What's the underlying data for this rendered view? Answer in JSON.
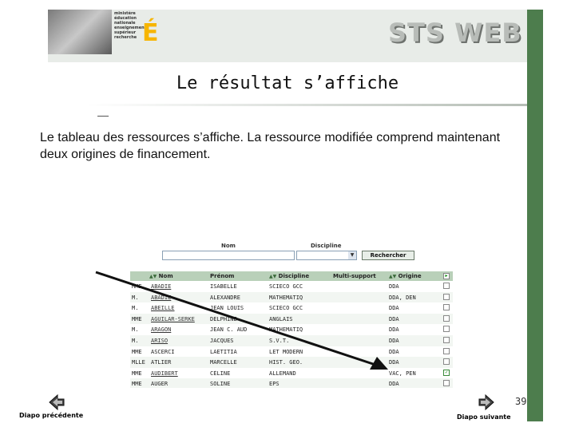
{
  "header": {
    "ministry_lines": [
      "ministère",
      "éducation",
      "nationale",
      "enseignement",
      "supérieur",
      "recherche"
    ],
    "logo_letter": "É",
    "app_logo": "STS WEB"
  },
  "slide": {
    "title": "Le résultat s’affiche",
    "description": "Le tableau des ressources s’affiche. La ressource modifiée comprend maintenant deux origines de financement.",
    "page_number": "39"
  },
  "app": {
    "search": {
      "nom_label": "Nom",
      "discipline_label": "Discipline",
      "nom_value": "",
      "discipline_value": "",
      "search_button": "Rechercher"
    },
    "columns": {
      "nom": "Nom",
      "prenom": "Prénom",
      "discipline": "Discipline",
      "multi_support": "Multi-support",
      "origine": "Origine"
    },
    "rows": [
      {
        "civ": "MME",
        "nom": "ABADIE",
        "prenom": "ISABELLE",
        "discipline": "SCIECO GCC",
        "origine": "DDA"
      },
      {
        "civ": "M.",
        "nom": "ABADIE",
        "prenom": "ALEXANDRE",
        "discipline": "MATHEMATIQ",
        "origine": "DDA, DEN"
      },
      {
        "civ": "M.",
        "nom": "ABEILLE",
        "prenom": "JEAN LOUIS",
        "discipline": "SCIECO GCC",
        "origine": "DDA"
      },
      {
        "civ": "MME",
        "nom": "AGUILAR-SERKE",
        "prenom": "DELPHINE",
        "discipline": "ANGLAIS",
        "origine": "DDA"
      },
      {
        "civ": "M.",
        "nom": "ARAGON",
        "prenom": "JEAN C. AUD",
        "discipline": "MATHEMATIQ",
        "origine": "DDA"
      },
      {
        "civ": "M.",
        "nom": "ARISO",
        "prenom": "JACQUES",
        "discipline": "S.V.T.",
        "origine": "DDA"
      },
      {
        "civ": "MME",
        "nom": "ASCERCI",
        "prenom": "LAETITIA",
        "discipline": "LET MODERN",
        "origine": "DDA"
      },
      {
        "civ": "MLLE",
        "nom": "ATLIER",
        "prenom": "MARCELLE",
        "discipline": "HIST. GEO.",
        "origine": "DDA"
      },
      {
        "civ": "MME",
        "nom": "AUDIBERT",
        "prenom": "CÉLINE",
        "discipline": "ALLEMAND",
        "origine": "VAC, PEN"
      },
      {
        "civ": "MME",
        "nom": "AUGER",
        "prenom": "SOLINE",
        "discipline": "EPS",
        "origine": "DDA"
      }
    ]
  },
  "navigation": {
    "prev_label": "Diapo précédente",
    "next_label": "Diapo suivante"
  },
  "colors": {
    "accent_green": "#4d7d4d",
    "grid_header": "#b9d0b9"
  }
}
